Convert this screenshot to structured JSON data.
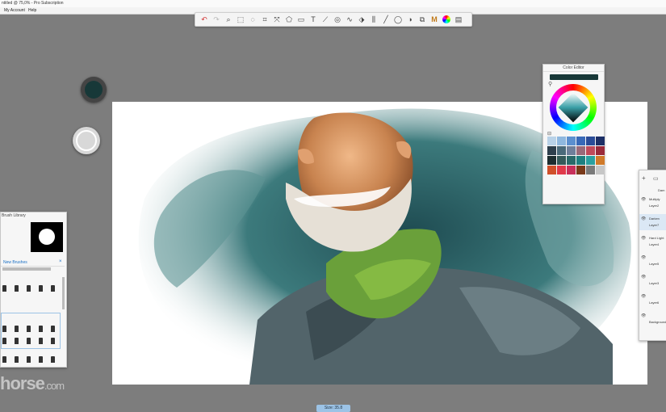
{
  "window": {
    "title": "ntitled @ 75,0% - Pro Subscription"
  },
  "menu": [
    {
      "label": "My Account"
    },
    {
      "label": "Help"
    }
  ],
  "toolbar": {
    "tools": [
      {
        "name": "undo-icon",
        "glyph": "↶"
      },
      {
        "name": "redo-icon",
        "glyph": "↷"
      },
      {
        "name": "zoom-icon",
        "glyph": "⌕"
      },
      {
        "name": "select-icon",
        "glyph": "⬚"
      },
      {
        "name": "lasso-icon",
        "glyph": "◌"
      },
      {
        "name": "crop-icon",
        "glyph": "⌗"
      },
      {
        "name": "transform-icon",
        "glyph": "⤧"
      },
      {
        "name": "distort-icon",
        "glyph": "⬠"
      },
      {
        "name": "transform-box-icon",
        "glyph": "▭"
      },
      {
        "name": "text-icon",
        "glyph": "T"
      },
      {
        "name": "ruler-icon",
        "glyph": "⟋"
      },
      {
        "name": "ellipse-guide-icon",
        "glyph": "◎"
      },
      {
        "name": "french-curve-icon",
        "glyph": "∿"
      },
      {
        "name": "perspective-icon",
        "glyph": "⬗"
      },
      {
        "name": "symmetry-icon",
        "glyph": "⫼"
      },
      {
        "name": "stroke-icon",
        "glyph": "╱"
      },
      {
        "name": "shape-icon",
        "glyph": "◯"
      },
      {
        "name": "fill-icon",
        "glyph": "◑"
      },
      {
        "name": "flip-icon",
        "glyph": "⧉"
      },
      {
        "name": "brush-library-icon",
        "glyph": "M"
      },
      {
        "name": "color-wheel-icon",
        "glyph": "●"
      },
      {
        "name": "layers-icon",
        "glyph": "▤"
      }
    ]
  },
  "color_editor": {
    "title": "Color Editor",
    "current_color": "#173838",
    "swatches": [
      "#b9d2e8",
      "#8fb8df",
      "#5b8fcf",
      "#3869b8",
      "#2a4c98",
      "#1c2f66",
      "#2e3f4c",
      "#4a6a7a",
      "#6f7f9b",
      "#9a6a7a",
      "#c04a5a",
      "#9b2a3a",
      "#1d2d2f",
      "#355a5a",
      "#2a6a6a",
      "#1e8080",
      "#2aa0a0",
      "#d07a2a",
      "#d0502a",
      "#e03a4a",
      "#c8305a",
      "#7a3a1a",
      "#7a7a7a",
      "#c7c7c7"
    ]
  },
  "brush_library": {
    "title": "Brush Library",
    "set_name": "New Brushes"
  },
  "layers": {
    "tab": "Dam",
    "items": [
      {
        "blend": "Multiply",
        "name": "Layer2"
      },
      {
        "blend": "Darken",
        "name": "Layer7"
      },
      {
        "blend": "Hard Light",
        "name": "Layer4"
      },
      {
        "blend": "",
        "name": "Layer5"
      },
      {
        "blend": "",
        "name": "Layer3"
      },
      {
        "blend": "",
        "name": "Layer6"
      },
      {
        "blend": "",
        "name": "Background"
      }
    ]
  },
  "status": {
    "size": "Size: 35.8"
  },
  "watermark": {
    "text": "horse",
    "suffix": ".com"
  },
  "colors": {
    "accent": "#9cc3e6",
    "ui_bg": "#7d7d7d",
    "primary_color": "#173838"
  }
}
